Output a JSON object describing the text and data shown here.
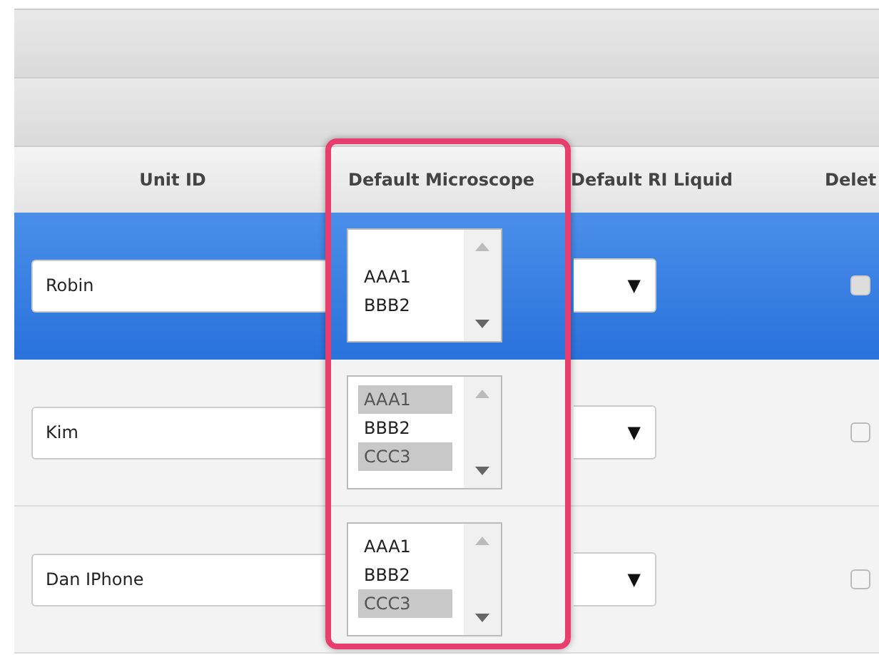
{
  "table": {
    "columns": [
      "Unit ID",
      "Default Microscope",
      "Default RI Liquid",
      "Delet"
    ],
    "rows": [
      {
        "selected": true,
        "unit_id": "Robin",
        "blank_option": true,
        "microscopes": [
          {
            "label": "AAA1",
            "selected": false
          },
          {
            "label": "BBB2",
            "selected": false
          }
        ],
        "ri_arrow": "▼",
        "delete_checked": false
      },
      {
        "selected": false,
        "unit_id": "Kim",
        "blank_option": false,
        "microscopes": [
          {
            "label": "AAA1",
            "selected": true
          },
          {
            "label": "BBB2",
            "selected": false
          },
          {
            "label": "CCC3",
            "selected": true
          }
        ],
        "ri_arrow": "▼",
        "delete_checked": false
      },
      {
        "selected": false,
        "unit_id": "Dan IPhone",
        "blank_option": false,
        "microscopes": [
          {
            "label": "AAA1",
            "selected": false
          },
          {
            "label": "BBB2",
            "selected": false
          },
          {
            "label": "CCC3",
            "selected": true
          }
        ],
        "ri_arrow": "▼",
        "delete_checked": false
      }
    ]
  }
}
